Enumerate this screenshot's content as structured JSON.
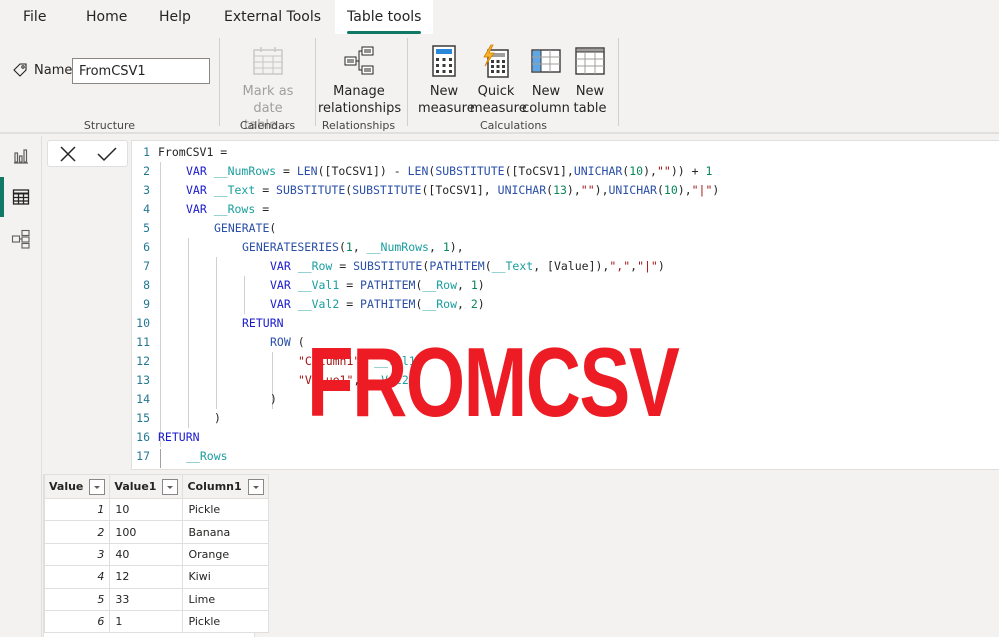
{
  "menu": {
    "tabs": [
      {
        "label": "File"
      },
      {
        "label": "Home"
      },
      {
        "label": "Help"
      },
      {
        "label": "External Tools"
      },
      {
        "label": "Table tools",
        "active": true
      }
    ]
  },
  "ribbon": {
    "structure": {
      "name_label": "Name",
      "name_value": "FromCSV1",
      "group_label": "Structure"
    },
    "calendars": {
      "mark_as_date_line1": "Mark as date",
      "mark_as_date_line2": "table ⌄",
      "group_label": "Calendars"
    },
    "relationships": {
      "manage_line1": "Manage",
      "manage_line2": "relationships",
      "group_label": "Relationships"
    },
    "calculations": {
      "new_measure_line1": "New",
      "new_measure_line2": "measure",
      "quick_measure_line1": "Quick",
      "quick_measure_line2": "measure",
      "new_column_line1": "New",
      "new_column_line2": "column",
      "new_table_line1": "New",
      "new_table_line2": "table",
      "group_label": "Calculations"
    }
  },
  "sidebar": {
    "items": [
      {
        "icon": "report-view-icon"
      },
      {
        "icon": "data-view-icon",
        "active": true
      },
      {
        "icon": "model-view-icon"
      }
    ]
  },
  "formula_bar": {
    "cancel_icon": "x-icon",
    "commit_icon": "check-icon"
  },
  "editor": {
    "lines": [
      "1",
      "2",
      "3",
      "4",
      "5",
      "6",
      "7",
      "8",
      "9",
      "10",
      "11",
      "12",
      "13",
      "14",
      "15",
      "16",
      "17"
    ],
    "code": {
      "l1": "FromCSV1 =",
      "l2_kw": "VAR",
      "l2_var": "__NumRows",
      "l2_rest_a": " = ",
      "l2_fn1": "LEN",
      "l2_rest_b": "([ToCSV1]) - ",
      "l2_fn2": "LEN",
      "l2_rest_c": "(",
      "l2_fn3": "SUBSTITUTE",
      "l2_rest_d": "([ToCSV1],",
      "l2_fn4": "UNICHAR",
      "l2_rest_e": "(",
      "l2_num1": "10",
      "l2_rest_f": "),",
      "l2_str1": "\"\"",
      "l2_rest_g": ")) + ",
      "l2_num2": "1",
      "l3_kw": "VAR",
      "l3_var": "__Text",
      "l3_rest_a": " = ",
      "l3_fn1": "SUBSTITUTE",
      "l3_rest_b": "(",
      "l3_fn2": "SUBSTITUTE",
      "l3_rest_c": "([ToCSV1], ",
      "l3_fn3": "UNICHAR",
      "l3_rest_d": "(",
      "l3_num1": "13",
      "l3_rest_e": "),",
      "l3_str1": "\"\"",
      "l3_rest_f": "),",
      "l3_fn4": "UNICHAR",
      "l3_rest_g": "(",
      "l3_num2": "10",
      "l3_rest_h": "),",
      "l3_str2": "\"|\"",
      "l3_rest_i": ")",
      "l4_kw": "VAR",
      "l4_var": "__Rows",
      "l4_rest": " =",
      "l5_fn": "GENERATE",
      "l5_rest": "(",
      "l6_fn": "GENERATESERIES",
      "l6_rest_a": "(",
      "l6_num1": "1",
      "l6_rest_b": ", ",
      "l6_var": "__NumRows",
      "l6_rest_c": ", ",
      "l6_num2": "1",
      "l6_rest_d": "),",
      "l7_kw": "VAR",
      "l7_var": "__Row",
      "l7_rest_a": " = ",
      "l7_fn1": "SUBSTITUTE",
      "l7_rest_b": "(",
      "l7_fn2": "PATHITEM",
      "l7_rest_c": "(",
      "l7_var2": "__Text",
      "l7_rest_d": ", [Value]),",
      "l7_str1": "\",\"",
      "l7_rest_e": ",",
      "l7_str2": "\"|\"",
      "l7_rest_f": ")",
      "l8_kw": "VAR",
      "l8_var": "__Val1",
      "l8_rest_a": " = ",
      "l8_fn": "PATHITEM",
      "l8_rest_b": "(",
      "l8_var2": "__Row",
      "l8_rest_c": ", ",
      "l8_num": "1",
      "l8_rest_d": ")",
      "l9_kw": "VAR",
      "l9_var": "__Val2",
      "l9_rest_a": " = ",
      "l9_fn": "PATHITEM",
      "l9_rest_b": "(",
      "l9_var2": "__Row",
      "l9_rest_c": ", ",
      "l9_num": "2",
      "l9_rest_d": ")",
      "l10_kw": "RETURN",
      "l11_fn": "ROW",
      "l11_rest": " (",
      "l12_str": "\"Column1\"",
      "l12_rest": ", ",
      "l12_var": "__Val1",
      "l13_str": "\"Value1\"",
      "l13_rest": ", ",
      "l13_var": "__Val2",
      "l14": ")",
      "l15": ")",
      "l16_kw": "RETURN",
      "l17_var": "__Rows"
    }
  },
  "overlay_text": "FROMCSV",
  "table": {
    "columns": [
      "Value",
      "Value1",
      "Column1"
    ],
    "rows": [
      [
        "1",
        "10",
        "Pickle"
      ],
      [
        "2",
        "100",
        "Banana"
      ],
      [
        "3",
        "40",
        "Orange"
      ],
      [
        "4",
        "12",
        "Kiwi"
      ],
      [
        "5",
        "33",
        "Lime"
      ],
      [
        "6",
        "1",
        "Pickle"
      ]
    ]
  },
  "colors": {
    "accent": "#117865",
    "overlay": "#ed1c24",
    "keyword": "#1a1acd",
    "function": "#2a4fa6",
    "variable": "#1a9e9e",
    "number": "#098658",
    "string": "#a31515"
  }
}
